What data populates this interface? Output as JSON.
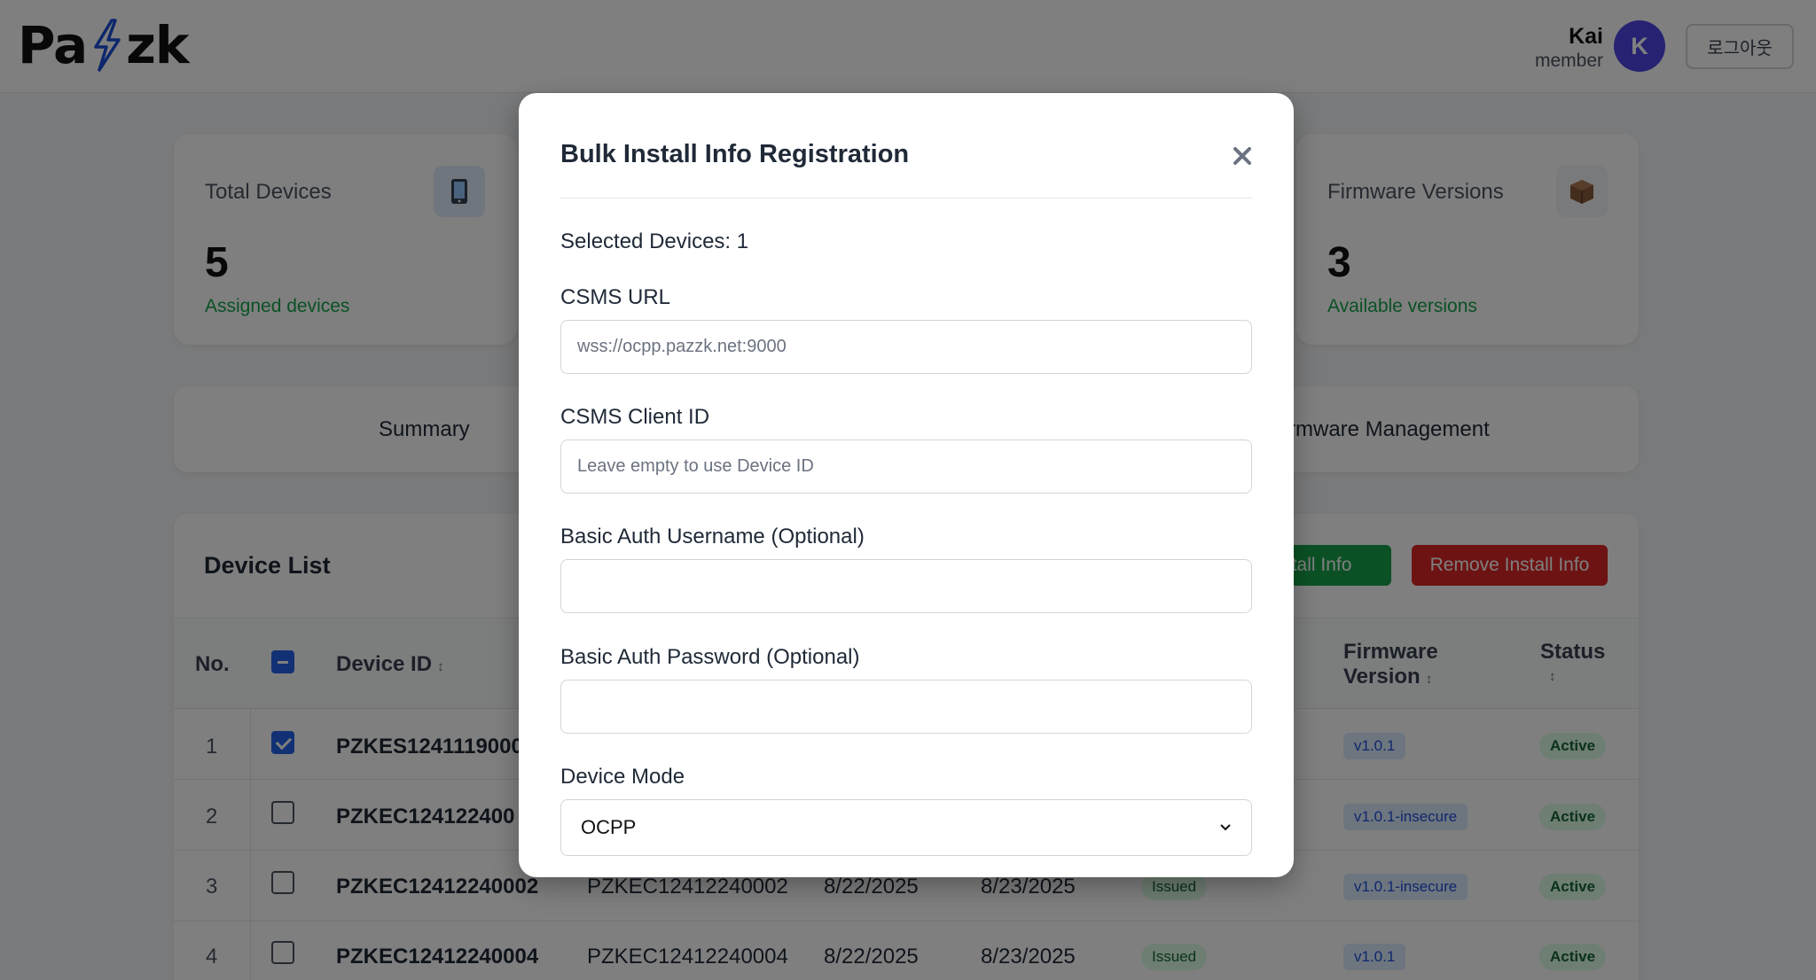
{
  "header": {
    "logo_text_left": "Pa",
    "logo_text_right": "zk",
    "user_name": "Kai",
    "user_role": "member",
    "avatar_initial": "K",
    "logout_label": "로그아웃"
  },
  "stats": [
    {
      "label": "Total Devices",
      "value": "5",
      "sub": "Assigned devices",
      "icon": "mobile-phone-icon"
    },
    {
      "label": "Firmware Versions",
      "value": "3",
      "sub": "Available versions",
      "icon": "package-box-icon"
    }
  ],
  "tabs": {
    "summary": "Summary",
    "firmware": "rmware Management"
  },
  "device_list": {
    "title": "Device List",
    "install_btn": "nstall Info",
    "remove_btn": "Remove Install Info",
    "columns": {
      "no": "No.",
      "device_id": "Device ID",
      "firmware_line1": "Firmware",
      "firmware_line2": "Version",
      "status": "Status"
    },
    "sort_glyph": "↕",
    "rows": [
      {
        "no": "1",
        "device_id": "PZKES1241119000",
        "col2": "",
        "date1": "",
        "date2": "",
        "issued": "",
        "firmware": "v1.0.1",
        "status": "Active",
        "checked": true
      },
      {
        "no": "2",
        "device_id": "PZKEC124122400",
        "col2": "",
        "date1": "",
        "date2": "",
        "issued": "",
        "firmware": "v1.0.1-insecure",
        "status": "Active",
        "checked": false
      },
      {
        "no": "3",
        "device_id": "PZKEC12412240002",
        "col2": "PZKEC12412240002",
        "date1": "8/22/2025",
        "date2": "8/23/2025",
        "issued": "Issued",
        "firmware": "v1.0.1-insecure",
        "status": "Active",
        "checked": false
      },
      {
        "no": "4",
        "device_id": "PZKEC12412240004",
        "col2": "PZKEC12412240004",
        "date1": "8/22/2025",
        "date2": "8/23/2025",
        "issued": "Issued",
        "firmware": "v1.0.1",
        "status": "Active",
        "checked": false
      }
    ]
  },
  "modal": {
    "title": "Bulk Install Info Registration",
    "selected_text": "Selected Devices: 1",
    "csms_url_label": "CSMS URL",
    "csms_url_placeholder": "wss://ocpp.pazzk.net:9000",
    "client_id_label": "CSMS Client ID",
    "client_id_placeholder": "Leave empty to use Device ID",
    "username_label": "Basic Auth Username (Optional)",
    "password_label": "Basic Auth Password (Optional)",
    "mode_label": "Device Mode",
    "mode_value": "OCPP"
  },
  "colors": {
    "accent": "#2563eb",
    "brand": "#1d4ed8",
    "success": "#16a34a",
    "danger": "#dc2626",
    "avatar": "#4f46e5"
  }
}
